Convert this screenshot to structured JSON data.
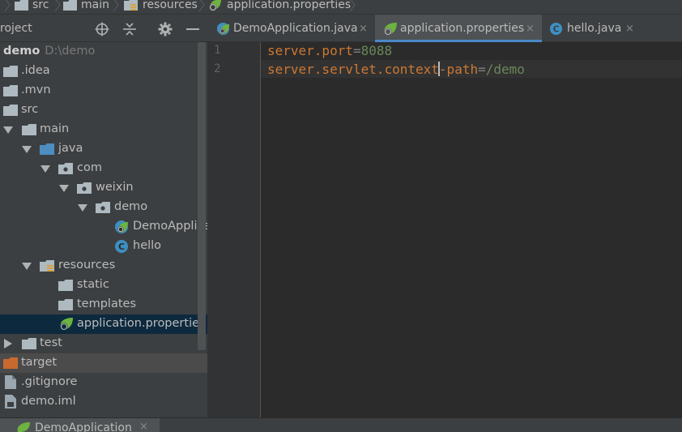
{
  "breadcrumb": {
    "items": [
      "src",
      "main",
      "resources",
      "application.properties"
    ]
  },
  "project_panel": {
    "title": "roject",
    "tree": [
      {
        "label": "demo",
        "path": "D:\\demo",
        "icon": "folder-icon"
      },
      {
        "label": ".idea",
        "icon": "folder-icon"
      },
      {
        "label": ".mvn",
        "icon": "folder-icon"
      },
      {
        "label": "src",
        "icon": "folder-icon"
      },
      {
        "label": "main",
        "icon": "folder-icon",
        "expanded": true
      },
      {
        "label": "java",
        "icon": "source-folder-icon",
        "expanded": true
      },
      {
        "label": "com",
        "icon": "package-icon",
        "expanded": true
      },
      {
        "label": "weixin",
        "icon": "package-icon",
        "expanded": true
      },
      {
        "label": "demo",
        "icon": "package-icon",
        "expanded": true
      },
      {
        "label": "DemoApplica",
        "icon": "spring-class-icon"
      },
      {
        "label": "hello",
        "icon": "class-icon"
      },
      {
        "label": "resources",
        "icon": "resources-folder-icon",
        "expanded": true
      },
      {
        "label": "static",
        "icon": "folder-icon"
      },
      {
        "label": "templates",
        "icon": "folder-icon"
      },
      {
        "label": "application.properties",
        "icon": "spring-properties-icon",
        "selected": true
      },
      {
        "label": "test",
        "icon": "folder-icon",
        "expanded": false
      },
      {
        "label": "target",
        "icon": "excluded-folder-icon"
      },
      {
        "label": ".gitignore",
        "icon": "file-icon"
      },
      {
        "label": "demo.iml",
        "icon": "module-file-icon"
      }
    ]
  },
  "tabs": [
    {
      "label": "DemoApplication.java",
      "icon": "spring-class-icon",
      "active": false
    },
    {
      "label": "application.properties",
      "icon": "spring-properties-icon",
      "active": true
    },
    {
      "label": "hello.java",
      "icon": "class-icon",
      "active": false
    }
  ],
  "tab_close_glyph": "×",
  "editor": {
    "line_numbers": [
      "1",
      "2"
    ],
    "lines": [
      {
        "key": "server.port",
        "sep": "=",
        "value": "8088"
      },
      {
        "key_before_caret": "server.servlet.context",
        "key_after_caret": "-path",
        "sep": "=",
        "value": "/demo"
      }
    ]
  },
  "bottom": {
    "tab_label": "DemoApplication",
    "close_glyph": "×"
  },
  "colors": {
    "key": "#cc7832",
    "value": "#6a8759",
    "selected_row": "#0d293e",
    "active_tab_underline": "#4a88c7",
    "excluded_folder": "#c86a2f",
    "class_icon": "#3d8fc2",
    "spring_green": "#6db33f"
  }
}
